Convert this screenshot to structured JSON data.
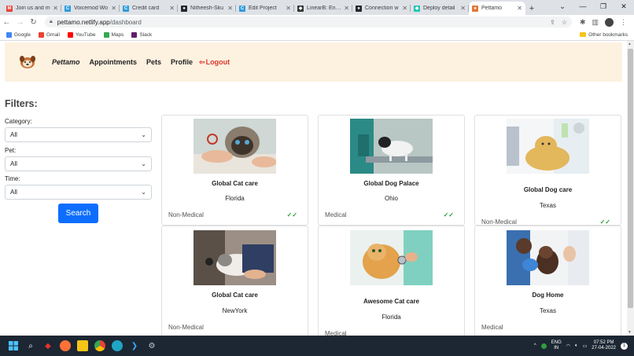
{
  "browser": {
    "tabs": [
      {
        "label": "Join us and m",
        "color": "#ea4335",
        "glyph": "M"
      },
      {
        "label": "Voicemod Wo",
        "color": "#2d9cdb",
        "glyph": "C"
      },
      {
        "label": "Credit card",
        "color": "#2d9cdb",
        "glyph": "C"
      },
      {
        "label": "Nitheesh-Sku",
        "color": "#24292e",
        "glyph": "●"
      },
      {
        "label": "Edit Project",
        "color": "#2d9cdb",
        "glyph": "C"
      },
      {
        "label": "LinearB: Engin",
        "color": "#333333",
        "glyph": "◆"
      },
      {
        "label": "Connection w",
        "color": "#24292e",
        "glyph": "●"
      },
      {
        "label": "Deploy detail",
        "color": "#20c6b7",
        "glyph": "◆"
      },
      {
        "label": "Pettamo",
        "color": "#e07b39",
        "glyph": "●"
      }
    ],
    "url_host": "pettamo.netlify.app",
    "url_path": "/dashboard",
    "bookmarks": [
      {
        "label": "Google",
        "color": "#4285f4"
      },
      {
        "label": "Gmail",
        "color": "#ea4335"
      },
      {
        "label": "YouTube",
        "color": "#ff0000"
      },
      {
        "label": "Maps",
        "color": "#34a853"
      },
      {
        "label": "Slack",
        "color": "#611f69"
      }
    ],
    "other_bookmarks": "Other bookmarks"
  },
  "nav": {
    "brand": "Pettamo",
    "links": [
      "Appointments",
      "Pets",
      "Profile"
    ],
    "logout": "Logout",
    "logout_icon": "⇦"
  },
  "filters": {
    "title": "Filters:",
    "category": {
      "label": "Category:",
      "value": "All"
    },
    "pet": {
      "label": "Pet:",
      "value": "All"
    },
    "time": {
      "label": "Time:",
      "value": "All"
    },
    "search_label": "Search"
  },
  "cards": [
    {
      "name": "Global Cat care",
      "location": "Florida",
      "type": "Non-Medical",
      "verified": true,
      "image": "cat-grooming-photo"
    },
    {
      "name": "Global Dog Palace",
      "location": "Ohio",
      "type": "Medical",
      "verified": true,
      "image": "dog-clinic-photo"
    },
    {
      "name": "Global Dog care",
      "location": "Texas",
      "type": "Non-Medical",
      "verified": true,
      "image": "dog-bath-illustration"
    },
    {
      "name": "Global Cat care",
      "location": "NewYork",
      "type": "Non-Medical",
      "verified": false,
      "image": "cat-vet-photo"
    },
    {
      "name": "Awesome Cat care",
      "location": "Florida",
      "type": "Medical",
      "verified": false,
      "image": "cat-stethoscope-photo"
    },
    {
      "name": "Dog Home",
      "location": "Texas",
      "type": "Medical",
      "verified": false,
      "image": "dog-vet-photo"
    }
  ],
  "check_glyph": "✓✓",
  "taskbar": {
    "lang_top": "ENG",
    "lang_bottom": "IN",
    "time": "07:52 PM",
    "date": "27-04-2022",
    "notification_count": "1"
  }
}
